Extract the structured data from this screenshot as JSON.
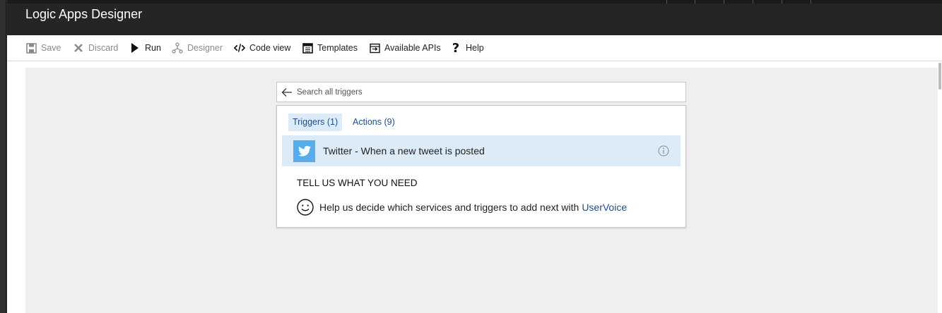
{
  "header": {
    "title": "Logic Apps Designer"
  },
  "toolbar": {
    "save_label": "Save",
    "discard_label": "Discard",
    "run_label": "Run",
    "designer_label": "Designer",
    "codeview_label": "Code view",
    "templates_label": "Templates",
    "apis_label": "Available APIs",
    "help_label": "Help"
  },
  "search": {
    "placeholder": "Search all triggers",
    "value": ""
  },
  "tabs": [
    {
      "label": "Triggers (1)",
      "active": true
    },
    {
      "label": "Actions (9)",
      "active": false
    }
  ],
  "triggers": [
    {
      "label": "Twitter - When a new tweet is posted",
      "icon": "twitter-icon",
      "color": "#55acee"
    }
  ],
  "feedback": {
    "heading": "TELL US WHAT YOU NEED",
    "text": "Help us decide which services and triggers to add next with",
    "link": "UserVoice"
  },
  "colors": {
    "accent": "#1e4e8c",
    "selection": "#dcebf8",
    "twitter": "#55acee"
  }
}
